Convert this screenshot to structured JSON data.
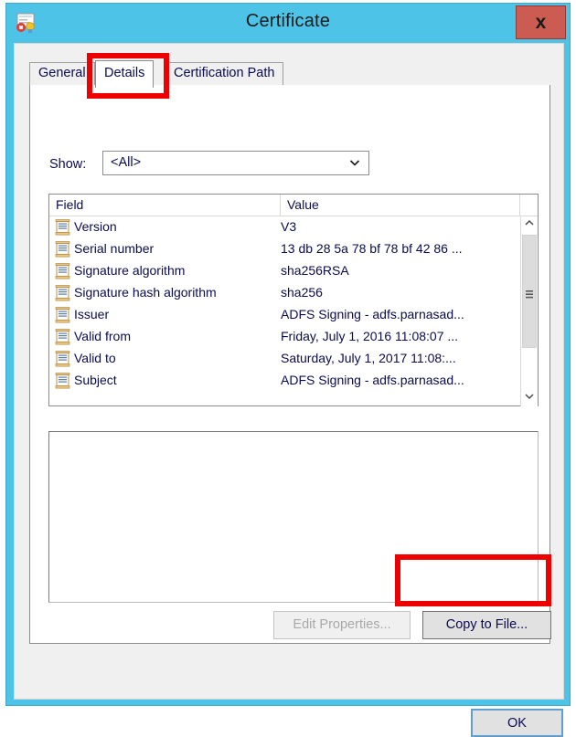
{
  "window": {
    "title": "Certificate",
    "icon": "certificate-error-icon",
    "close_label": "x",
    "frame_color": "#4EC3E8",
    "close_button_color": "#cc5c52"
  },
  "tabs": [
    {
      "label": "General",
      "active": false,
      "name": "tab-general"
    },
    {
      "label": "Details",
      "active": true,
      "name": "tab-details"
    },
    {
      "label": "Certification Path",
      "active": false,
      "name": "tab-certpath"
    }
  ],
  "show": {
    "label": "Show:",
    "selected": "<All>",
    "icon": "chevron-down-icon"
  },
  "list": {
    "columns": [
      "Field",
      "Value"
    ],
    "rows": [
      {
        "field": "Version",
        "value": "V3"
      },
      {
        "field": "Serial number",
        "value": "13 db 28 5a 78 bf 78 bf 42 86 ..."
      },
      {
        "field": "Signature algorithm",
        "value": "sha256RSA"
      },
      {
        "field": "Signature hash algorithm",
        "value": "sha256"
      },
      {
        "field": "Issuer",
        "value": "ADFS Signing - adfs.parnasad..."
      },
      {
        "field": "Valid from",
        "value": "Friday, July 1, 2016 11:08:07 ..."
      },
      {
        "field": "Valid to",
        "value": "Saturday, July 1, 2017 11:08:..."
      },
      {
        "field": "Subject",
        "value": "ADFS Signing - adfs.parnasad..."
      }
    ],
    "scrollbar": {
      "up_icon": "chevron-up-icon",
      "down_icon": "chevron-down-icon",
      "thumb_grip_icon": "grip-lines-icon"
    }
  },
  "detail_pane": {
    "text": ""
  },
  "buttons": {
    "edit_properties": {
      "label": "Edit Properties...",
      "enabled": false
    },
    "copy_to_file": {
      "label": "Copy to File...",
      "enabled": true
    },
    "ok": {
      "label": "OK",
      "focused": true
    }
  },
  "annotations": {
    "color": "#ee0000",
    "items": [
      {
        "target": "Details tab"
      },
      {
        "target": "Copy to File... button"
      }
    ]
  }
}
